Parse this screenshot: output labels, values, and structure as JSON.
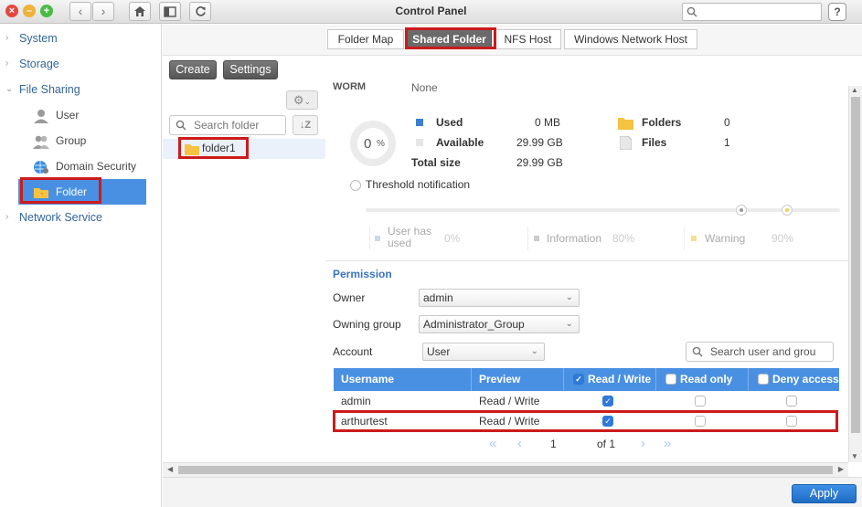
{
  "window": {
    "title": "Control Panel",
    "search_placeholder": ""
  },
  "sidebar": {
    "categories": [
      "System",
      "Storage",
      "File Sharing",
      "Network Service"
    ],
    "items": [
      "User",
      "Group",
      "Domain Security",
      "Folder"
    ]
  },
  "tabs": [
    "Folder Map",
    "Shared Folder",
    "NFS Host",
    "Windows Network Host"
  ],
  "folder_pane": {
    "create_label": "Create",
    "settings_label": "Settings",
    "search_placeholder": "Search folder",
    "folders": [
      "folder1"
    ]
  },
  "detail": {
    "worm_label": "WORM",
    "worm_value": "None",
    "usage_percent": "0",
    "usage_unit": "%",
    "used_label": "Used",
    "used_value": "0 MB",
    "available_label": "Available",
    "available_value": "29.99 GB",
    "total_label": "Total size",
    "total_value": "29.99 GB",
    "folders_label": "Folders",
    "folders_value": "0",
    "files_label": "Files",
    "files_value": "1",
    "threshold_label": "Threshold notification",
    "legend": {
      "user_has_used": "User has used",
      "user_has_used_value": "0%",
      "information": "Information",
      "information_value": "80%",
      "warning": "Warning",
      "warning_value": "90%"
    }
  },
  "permission": {
    "title": "Permission",
    "owner_label": "Owner",
    "owner_value": "admin",
    "owning_group_label": "Owning group",
    "owning_group_value": "Administrator_Group",
    "account_label": "Account",
    "account_value": "User",
    "search_placeholder": "Search user and grou",
    "columns": [
      "Username",
      "Preview",
      "Read / Write",
      "Read only",
      "Deny access"
    ],
    "rows": [
      {
        "username": "admin",
        "preview": "Read / Write"
      },
      {
        "username": "arthurtest",
        "preview": "Read / Write"
      }
    ],
    "pager": {
      "page": "1",
      "of": "of 1"
    }
  },
  "footer": {
    "apply_label": "Apply"
  },
  "colors": {
    "accent": "#4a90e2",
    "highlight": "#cc1b1b",
    "apply": "#2a7bd6"
  }
}
